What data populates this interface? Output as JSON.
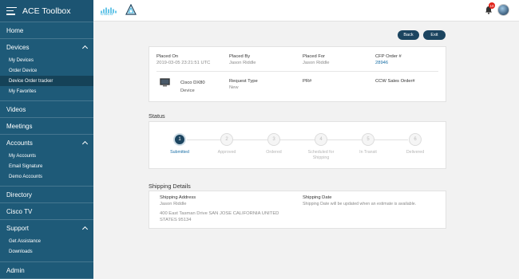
{
  "app": {
    "title": "ACE Toolbox"
  },
  "sidebar": {
    "home": "Home",
    "devices": {
      "label": "Devices",
      "items": [
        "My Devices",
        "Order Device",
        "Device Order tracker",
        "My Favorites"
      ]
    },
    "videos": "Videos",
    "meetings": "Meetings",
    "accounts": {
      "label": "Accounts",
      "items": [
        "My Accounts",
        "Email Signature",
        "Demo Accounts"
      ]
    },
    "directory": "Directory",
    "cisco_tv": "Cisco TV",
    "support": {
      "label": "Support",
      "items": [
        "Get Assistance",
        "Downloads"
      ]
    },
    "admin": "Admin"
  },
  "header": {
    "cisco_text": "CISCO",
    "notification_count": "10"
  },
  "actions": {
    "back": "Back",
    "exit": "Exit"
  },
  "order": {
    "placed_on_label": "Placed On",
    "placed_on": "2019-03-05 23:21:51 UTC",
    "placed_by_label": "Placed By",
    "placed_by": "Jason Riddle",
    "placed_for_label": "Placed For",
    "placed_for": "Jason Riddle",
    "cfp_label": "CFP Order #",
    "cfp": "28946",
    "device_name": "Cisco DX80",
    "device_type": "Device",
    "request_type_label": "Request Type",
    "request_type": "New",
    "pr_label": "PR#",
    "ccw_label": "CCW Sales Order#"
  },
  "status": {
    "title": "Status",
    "steps": [
      {
        "num": "1",
        "label": "Submitted"
      },
      {
        "num": "2",
        "label": "Approved"
      },
      {
        "num": "3",
        "label": "Ordered"
      },
      {
        "num": "4",
        "label": "Scheduled for Shipping"
      },
      {
        "num": "5",
        "label": "In Transit"
      },
      {
        "num": "6",
        "label": "Delivered"
      }
    ]
  },
  "shipping": {
    "title": "Shipping Details",
    "address_label": "Shipping Address",
    "name": "Jason Riddle",
    "address": "400 East Tasman Drive SAN JOSE CALIFORNIA UNITED STATES 95134",
    "date_label": "Shipping Date",
    "date_note": "Shipping Date will be updated when an estimate is available."
  }
}
